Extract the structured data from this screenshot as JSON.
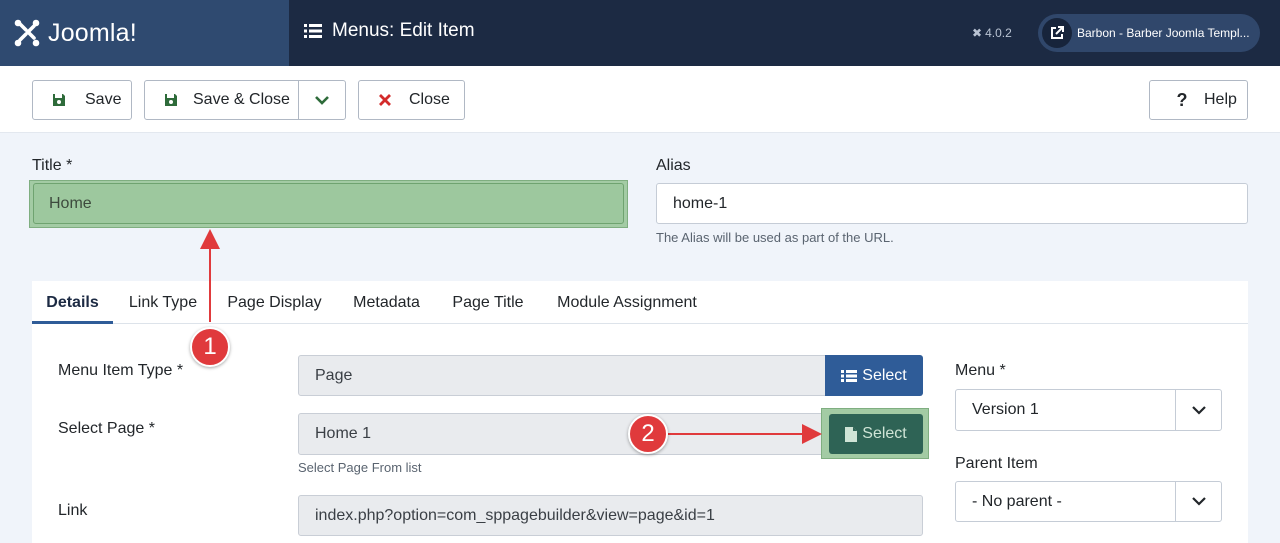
{
  "header": {
    "logo_text": "Joomla!",
    "page_title": "Menus: Edit Item",
    "version": "4.0.2",
    "site_button": "Barbon - Barber Joomla Templ..."
  },
  "toolbar": {
    "save_label": "Save",
    "save_close_label": "Save & Close",
    "close_label": "Close",
    "help_label": "Help"
  },
  "form": {
    "title_label": "Title *",
    "title_value": "Home",
    "alias_label": "Alias",
    "alias_value": "home-1",
    "alias_help": "The Alias will be used as part of the URL."
  },
  "tabs": [
    "Details",
    "Link Type",
    "Page Display",
    "Metadata",
    "Page Title",
    "Module Assignment"
  ],
  "details": {
    "menu_item_type_label": "Menu Item Type *",
    "menu_item_type_value": "Page",
    "select_button_label": "Select",
    "select_page_label": "Select Page *",
    "select_page_value": "Home 1",
    "select_page_button_label": "Select",
    "select_page_help": "Select Page From list",
    "link_label": "Link",
    "link_value": "index.php?option=com_sppagebuilder&view=page&id=1"
  },
  "sidebar": {
    "menu_label": "Menu *",
    "menu_value": "Version 1",
    "parent_label": "Parent Item",
    "parent_value": "- No parent -"
  },
  "annotations": [
    "1",
    "2"
  ],
  "colors": {
    "header_bg": "#1c2a43",
    "logo_bg": "#2f4a70",
    "primary_button": "#2f5c98",
    "highlight": "#a3cba4",
    "annotation": "#e03a3c",
    "select_page_button": "#2e6355"
  }
}
